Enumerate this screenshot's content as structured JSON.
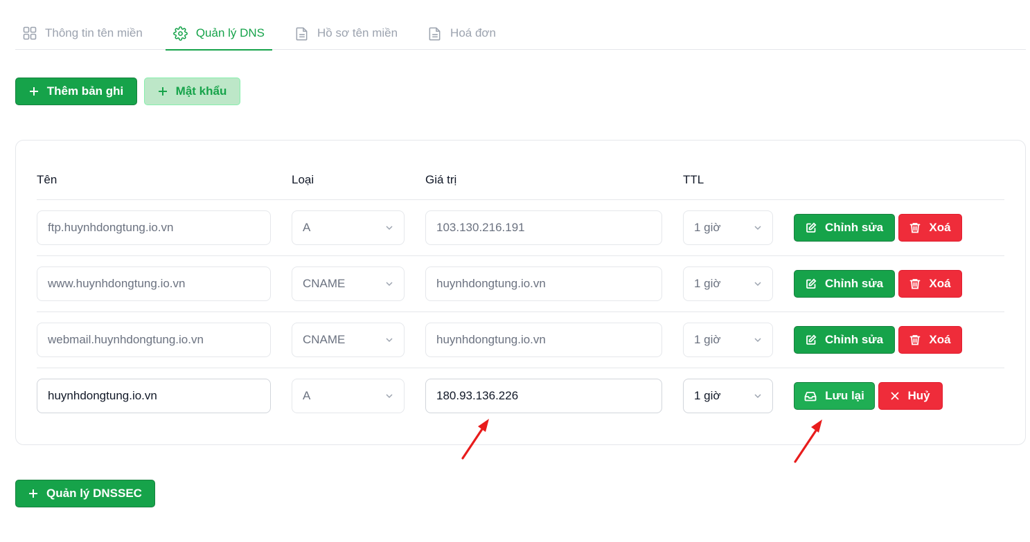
{
  "tabs": [
    {
      "label": "Thông tin tên miền",
      "icon": "grid-icon"
    },
    {
      "label": "Quản lý DNS",
      "icon": "gear-icon"
    },
    {
      "label": "Hồ sơ tên miền",
      "icon": "document-icon"
    },
    {
      "label": "Hoá đơn",
      "icon": "document-icon"
    }
  ],
  "toolbar": {
    "add_record": "Thêm bản ghi",
    "password": "Mật khẩu"
  },
  "table": {
    "headers": [
      "Tên",
      "Loại",
      "Giá trị",
      "TTL"
    ],
    "rows": [
      {
        "name": "ftp.huynhdongtung.io.vn",
        "type": "A",
        "value": "103.130.216.191",
        "ttl": "1 giờ",
        "action1": "Chỉnh sửa",
        "action2": "Xoá"
      },
      {
        "name": "www.huynhdongtung.io.vn",
        "type": "CNAME",
        "value": "huynhdongtung.io.vn",
        "ttl": "1 giờ",
        "action1": "Chỉnh sửa",
        "action2": "Xoá"
      },
      {
        "name": "webmail.huynhdongtung.io.vn",
        "type": "CNAME",
        "value": "huynhdongtung.io.vn",
        "ttl": "1 giờ",
        "action1": "Chỉnh sửa",
        "action2": "Xoá"
      },
      {
        "name": "huynhdongtung.io.vn",
        "type": "A",
        "value": "180.93.136.226",
        "ttl": "1 giờ",
        "action1": "Lưu lại",
        "action2": "Huỷ"
      }
    ]
  },
  "footer": {
    "dnssec": "Quản lý DNSSEC"
  },
  "colors": {
    "primary_green": "#16a34a",
    "danger_red": "#ef2c3a",
    "annotation_arrow": "#e81c1c"
  }
}
